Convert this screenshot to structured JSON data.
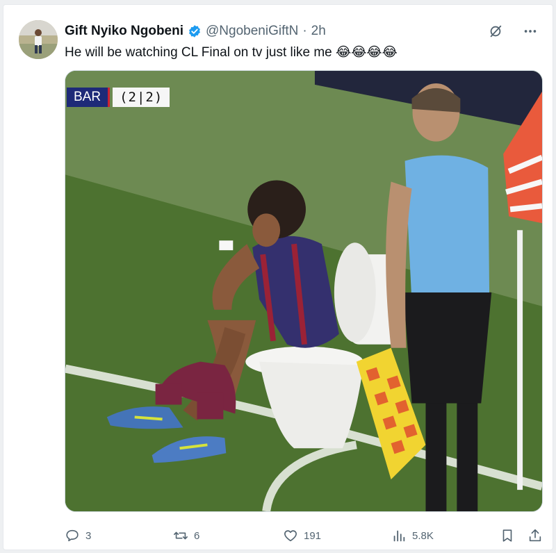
{
  "tweet": {
    "display_name": "Gift Nyiko Ngobeni",
    "handle": "@NgobeniGiftN",
    "separator": "·",
    "time": "2h",
    "text": "He will be watching CL Final on tv just like me 😂😂😂😂",
    "verified_color": "#1d9bf0"
  },
  "media": {
    "score_team": "BAR",
    "score_value": "(2|2)"
  },
  "actions": {
    "replies": "3",
    "reposts": "6",
    "likes": "191",
    "views": "5.8K"
  },
  "icons": [
    "grok-icon",
    "more-icon",
    "reply-icon",
    "repost-icon",
    "like-icon",
    "views-icon",
    "bookmark-icon",
    "share-icon"
  ]
}
